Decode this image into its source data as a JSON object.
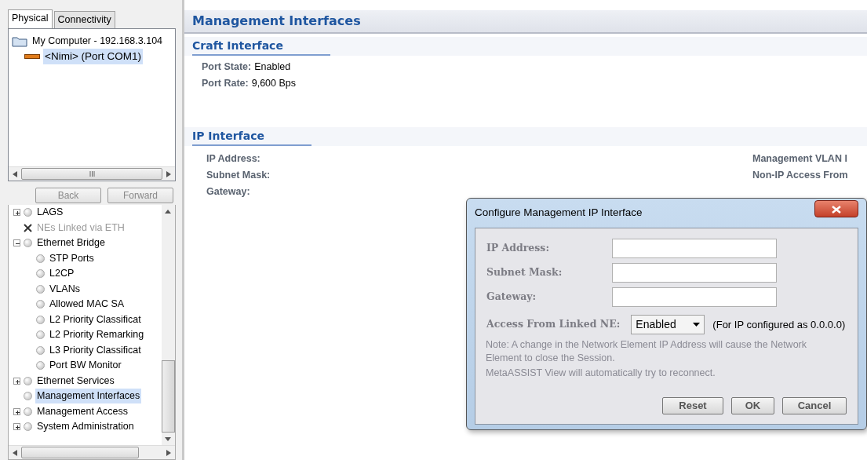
{
  "tabs": [
    {
      "label": "Physical",
      "selected": true
    },
    {
      "label": "Connectivity",
      "selected": false
    }
  ],
  "device_tree": [
    {
      "label": "My Computer - 192.168.3.104",
      "kind": "computer",
      "selected": false,
      "children": [
        {
          "label": "<Nimi>",
          "detail": "(Port COM1)",
          "kind": "device",
          "selected": true
        }
      ]
    }
  ],
  "nav_buttons": [
    {
      "label": "Back",
      "disabled": true
    },
    {
      "label": "Forward",
      "disabled": true
    }
  ],
  "menu_tree": [
    {
      "label": "LAGS",
      "kind": "status",
      "expanded": false,
      "selected": false,
      "disabled": false
    },
    {
      "label": "NEs Linked via ETH",
      "kind": "unavailable",
      "selected": false,
      "disabled": true
    },
    {
      "label": "Ethernet Bridge",
      "kind": "status",
      "expanded": true,
      "selected": false,
      "disabled": false,
      "children": [
        {
          "label": "STP Ports",
          "kind": "status",
          "selected": false,
          "disabled": false
        },
        {
          "label": "L2CP",
          "kind": "status",
          "selected": false,
          "disabled": false
        },
        {
          "label": "VLANs",
          "kind": "status",
          "selected": false,
          "disabled": false
        },
        {
          "label": "Allowed MAC SA",
          "kind": "status",
          "selected": false,
          "disabled": false
        },
        {
          "label": "L2 Priority Classificat",
          "kind": "status",
          "selected": false,
          "disabled": false
        },
        {
          "label": "L2 Priority Remarking",
          "kind": "status",
          "selected": false,
          "disabled": false
        },
        {
          "label": "L3 Priority Classificat",
          "kind": "status",
          "selected": false,
          "disabled": false
        },
        {
          "label": "Port BW Monitor",
          "kind": "status",
          "selected": false,
          "disabled": false
        }
      ]
    },
    {
      "label": "Ethernet Services",
      "kind": "status",
      "expanded": false,
      "selected": false,
      "disabled": false
    },
    {
      "label": "Management Interfaces",
      "kind": "status",
      "selected": true,
      "disabled": false
    },
    {
      "label": "Management Access",
      "kind": "status",
      "expanded": false,
      "selected": false,
      "disabled": false
    },
    {
      "label": "System Administration",
      "kind": "status",
      "expanded": false,
      "selected": false,
      "disabled": false
    }
  ],
  "page": {
    "title": "Management Interfaces",
    "craft_interface": {
      "title": "Craft Interface",
      "fields": [
        {
          "label": "Port State:",
          "value": "Enabled"
        },
        {
          "label": "Port Rate:",
          "value": "9,600 Bps"
        }
      ]
    },
    "ip_interface": {
      "title": "IP Interface",
      "fields": [
        {
          "label": "IP Address:"
        },
        {
          "label": "Subnet Mask:"
        },
        {
          "label": "Gateway:"
        }
      ],
      "column_2_fields": [
        {
          "label": "Management VLAN I"
        },
        {
          "label": "Non-IP Access From"
        }
      ]
    }
  },
  "dialog": {
    "title": "Configure Management IP Interface",
    "fields": [
      {
        "label": "IP Address:"
      },
      {
        "label": "Subnet Mask:"
      },
      {
        "label": "Gateway:"
      }
    ],
    "access": {
      "label": "Access From Linked NE:",
      "value": "Enabled",
      "hint": "(For IP configured as 0.0.0.0)"
    },
    "note": [
      "Note: A change in the Network Element IP Address will cause the Network Element to close the Session.",
      "MetaASSIST View will automatically try to reconnect."
    ],
    "buttons": [
      "Reset",
      "OK",
      "Cancel"
    ]
  }
}
